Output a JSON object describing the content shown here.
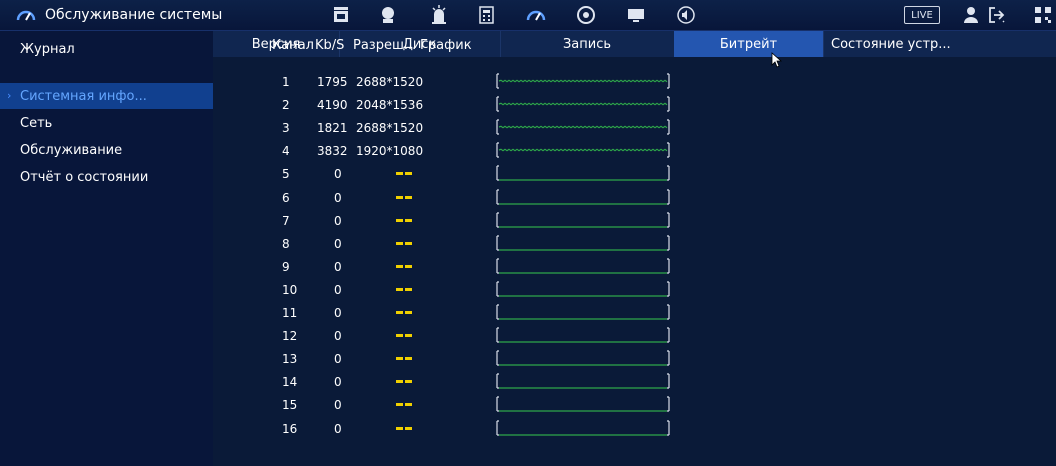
{
  "app": {
    "title": "Обслуживание системы",
    "live_label": "LIVE"
  },
  "topbar_icons": [
    "speedometer-icon",
    "video-clip-icon",
    "face-icon",
    "alarm-icon",
    "calculator-icon",
    "gauge-icon",
    "disc-icon",
    "monitor-icon",
    "speaker-icon"
  ],
  "sidebar": {
    "items": [
      {
        "label": "Журнал",
        "active": false
      },
      {
        "label": "Системная инфо...",
        "active": true
      },
      {
        "label": "Сеть",
        "active": false
      },
      {
        "label": "Обслуживание",
        "active": false
      },
      {
        "label": "Отчёт о состоянии",
        "active": false
      }
    ]
  },
  "tabs": [
    {
      "label": "Версия",
      "active": false
    },
    {
      "label": "Диск",
      "active": false
    },
    {
      "label": "Запись",
      "active": false
    },
    {
      "label": "Битрейт",
      "active": true
    },
    {
      "label": "Состояние устр...",
      "active": false
    }
  ],
  "table": {
    "columns": [
      "Канал",
      "Kb/S",
      "Разреш...",
      "График"
    ],
    "rows": [
      {
        "channel": "1",
        "kbs": "1795",
        "resolution": "2688*1520",
        "active": true
      },
      {
        "channel": "2",
        "kbs": "4190",
        "resolution": "2048*1536",
        "active": true
      },
      {
        "channel": "3",
        "kbs": "1821",
        "resolution": "2688*1520",
        "active": true
      },
      {
        "channel": "4",
        "kbs": "3832",
        "resolution": "1920*1080",
        "active": true
      },
      {
        "channel": "5",
        "kbs": "0",
        "resolution": "--",
        "active": false
      },
      {
        "channel": "6",
        "kbs": "0",
        "resolution": "--",
        "active": false
      },
      {
        "channel": "7",
        "kbs": "0",
        "resolution": "--",
        "active": false
      },
      {
        "channel": "8",
        "kbs": "0",
        "resolution": "--",
        "active": false
      },
      {
        "channel": "9",
        "kbs": "0",
        "resolution": "--",
        "active": false
      },
      {
        "channel": "10",
        "kbs": "0",
        "resolution": "--",
        "active": false
      },
      {
        "channel": "11",
        "kbs": "0",
        "resolution": "--",
        "active": false
      },
      {
        "channel": "12",
        "kbs": "0",
        "resolution": "--",
        "active": false
      },
      {
        "channel": "13",
        "kbs": "0",
        "resolution": "--",
        "active": false
      },
      {
        "channel": "14",
        "kbs": "0",
        "resolution": "--",
        "active": false
      },
      {
        "channel": "15",
        "kbs": "0",
        "resolution": "--",
        "active": false
      },
      {
        "channel": "16",
        "kbs": "0",
        "resolution": "--",
        "active": false
      }
    ]
  },
  "colors": {
    "background": "#0a1a38",
    "sidebar_active_bg": "#11408f",
    "sidebar_active_text": "#64a6ff",
    "tab_active_bg": "#2456b0",
    "graph_line": "#2ea84a",
    "dash": "#f0d000"
  }
}
